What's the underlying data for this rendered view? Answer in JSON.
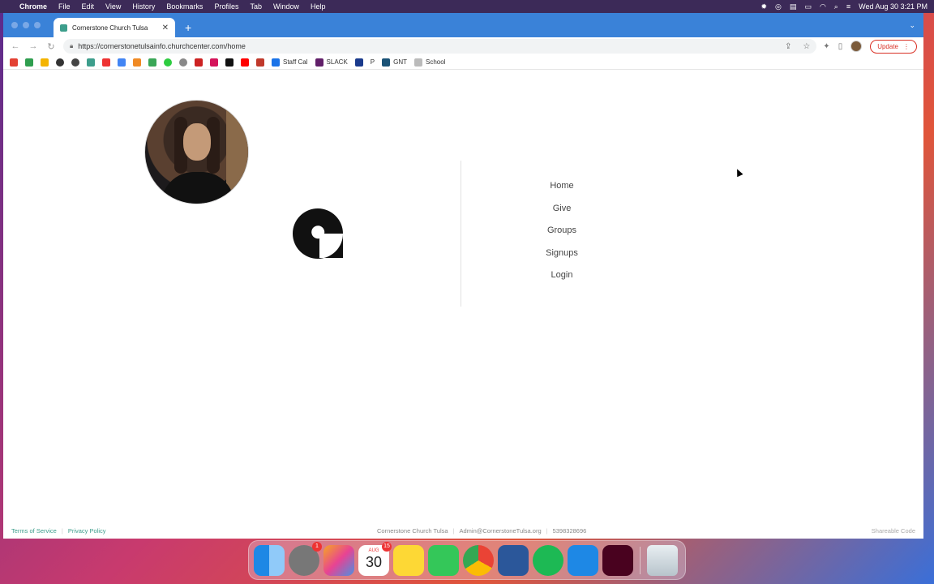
{
  "menubar": {
    "app": "Chrome",
    "items": [
      "File",
      "Edit",
      "View",
      "History",
      "Bookmarks",
      "Profiles",
      "Tab",
      "Window",
      "Help"
    ],
    "datetime": "Wed Aug 30  3:21 PM"
  },
  "browser": {
    "tab_title": "Cornerstone Church Tulsa",
    "url": "https://cornerstonetulsainfo.churchcenter.com/home",
    "update_label": "Update",
    "bookmarks": [
      "Staff Cal",
      "SLACK",
      "P",
      "GNT",
      "School"
    ]
  },
  "nav": {
    "items": [
      "Home",
      "Give",
      "Groups",
      "Signups",
      "Login"
    ]
  },
  "footer": {
    "terms": "Terms of Service",
    "privacy": "Privacy Policy",
    "org": "Cornerstone Church Tulsa",
    "email": "Admin@CornerstoneTulsa.org",
    "phone": "5398328696",
    "shareable": "Shareable Code"
  },
  "dock": {
    "calendar_month": "AUG",
    "calendar_day": "30",
    "settings_badge": "1",
    "calendar_badge": "15"
  },
  "colors": {
    "accent": "#3d9e8c",
    "chrome_blue": "#3a82d8",
    "update_red": "#d93025"
  }
}
